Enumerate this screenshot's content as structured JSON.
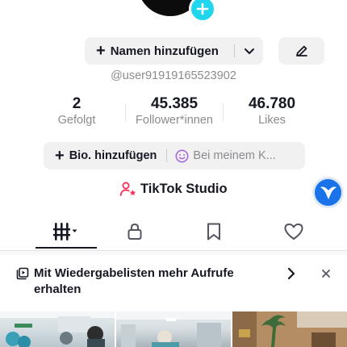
{
  "profile": {
    "name_button_label": "Namen hinzufügen",
    "username": "@user91919165523902"
  },
  "stats": [
    {
      "value": "2",
      "label": "Gefolgt"
    },
    {
      "value": "45.385",
      "label": "Follower*innen"
    },
    {
      "value": "46.780",
      "label": "Likes"
    }
  ],
  "bio": {
    "add_label": "Bio. hinzufügen",
    "alt_label": "Bei meinem K..."
  },
  "studio": {
    "label": "TikTok Studio"
  },
  "tabs": [
    {
      "icon": "videos-grid-icon",
      "selected": true
    },
    {
      "icon": "lock-icon",
      "selected": false
    },
    {
      "icon": "bookmark-icon",
      "selected": false
    },
    {
      "icon": "heart-icon",
      "selected": false
    }
  ],
  "banner": {
    "text": "Mit Wiedergabelisten mehr Aufrufe erhalten"
  },
  "colors": {
    "accent_cyan": "#20d5ec",
    "studio_pink": "#fe2c55",
    "text_primary": "#161823",
    "text_secondary": "#8a8b91",
    "button_bg": "#f1f1f2",
    "floating_blue": "#1a73e8"
  }
}
